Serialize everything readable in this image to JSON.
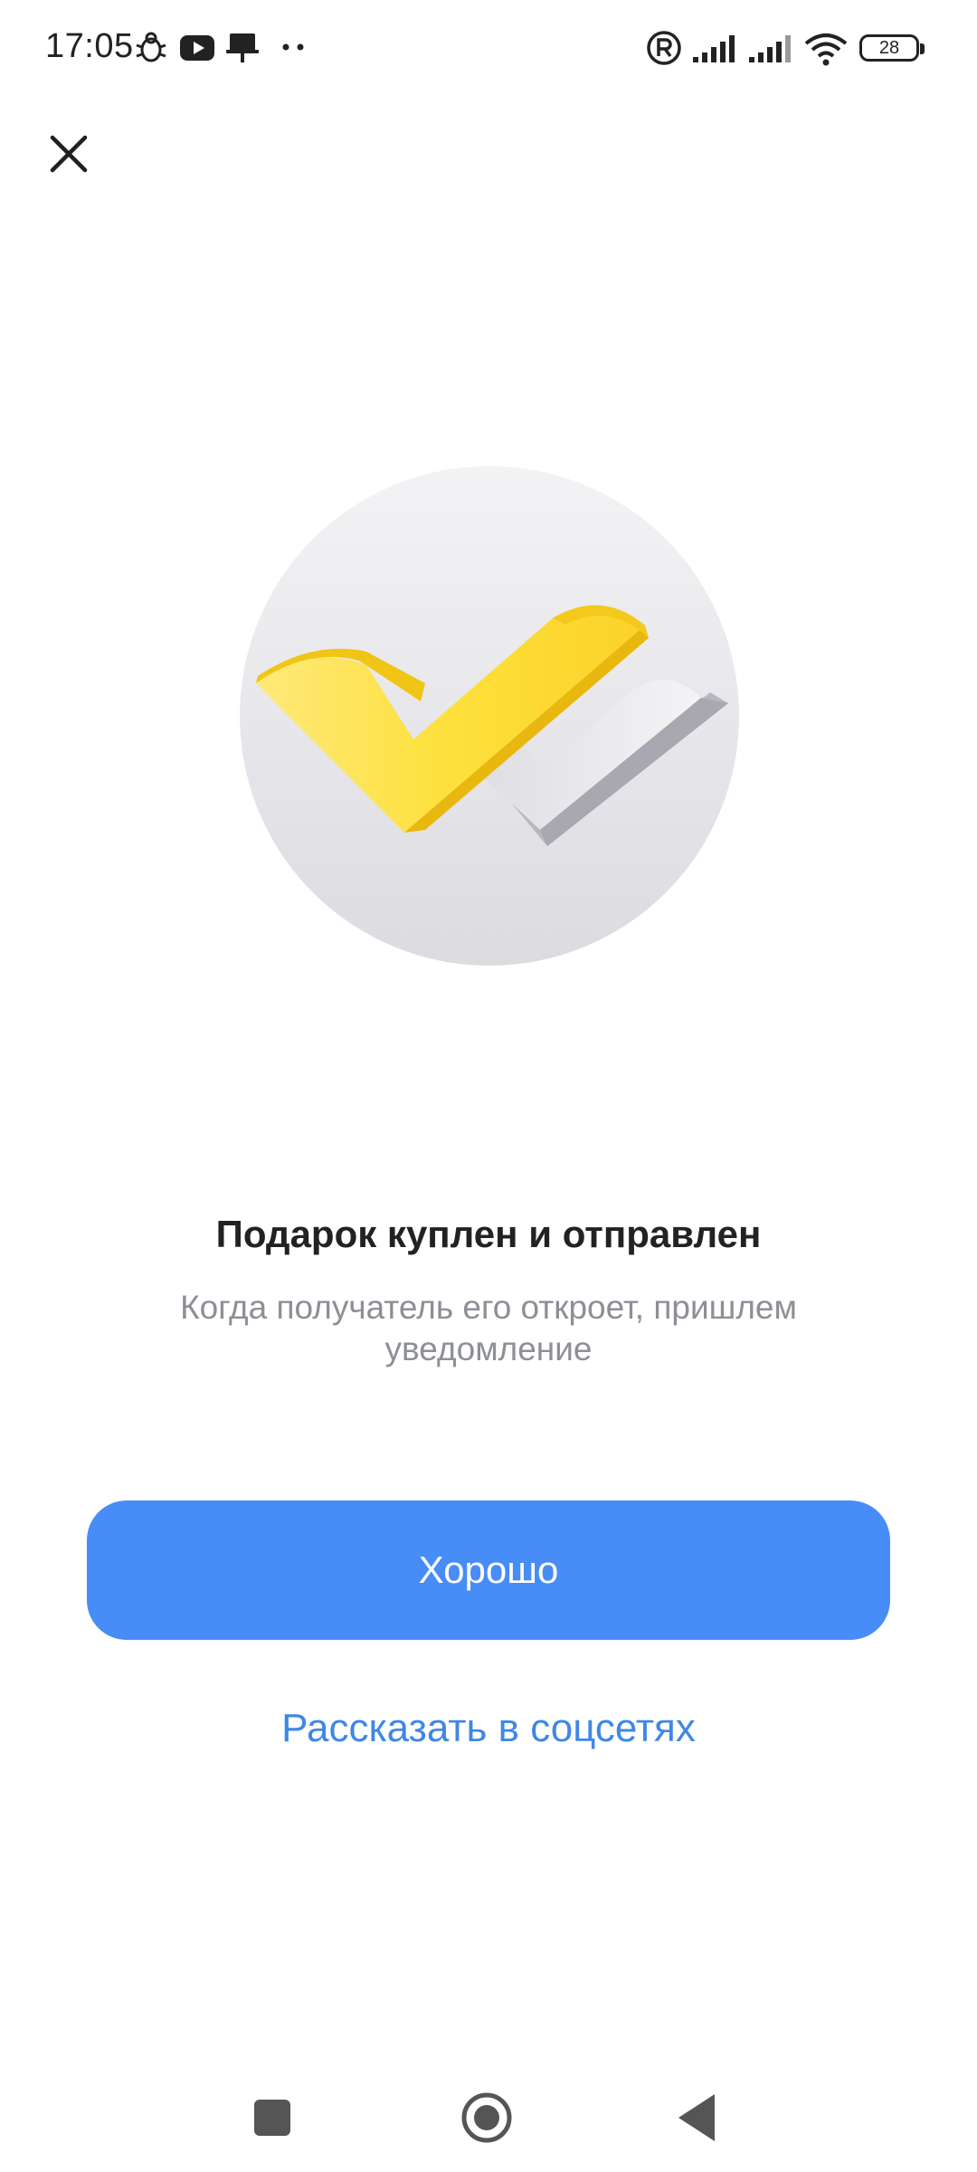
{
  "status_bar": {
    "time": "17:05",
    "battery_level": "28",
    "icons": [
      "bug-icon",
      "youtube-icon",
      "notification-icon",
      "more-dots-icon",
      "registered-icon",
      "signal-icon",
      "signal-icon",
      "wifi-icon",
      "battery-icon"
    ]
  },
  "header": {
    "close_icon": "close-icon"
  },
  "illustration": {
    "icon": "double-checkmark-icon",
    "colors": {
      "circle_top": "#f3f3f5",
      "circle_bottom": "#dedde2",
      "front_check": "#fcd72c",
      "back_check": "#d0cfd6"
    }
  },
  "content": {
    "title": "Подарок куплен и отправлен",
    "subtitle": "Когда получатель его откроет, пришлем уведомление"
  },
  "actions": {
    "primary_label": "Хорошо",
    "secondary_label": "Рассказать в соцсетях"
  },
  "colors": {
    "primary_button": "#478cf7",
    "link": "#3f87e6",
    "subtitle": "#8c8f95"
  },
  "nav_bar": {
    "icons": [
      "recent-apps-icon",
      "home-icon",
      "back-icon"
    ]
  }
}
